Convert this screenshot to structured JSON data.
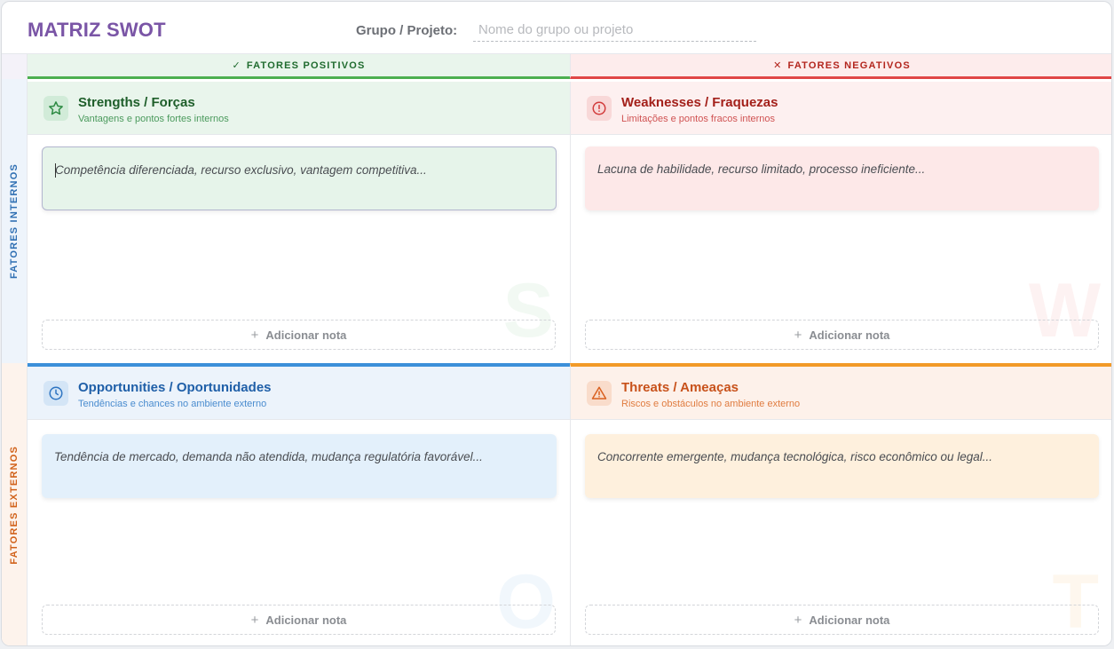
{
  "header": {
    "title": "MATRIZ SWOT",
    "group_label": "Grupo / Projeto:",
    "group_placeholder": "Nome do grupo ou projeto",
    "group_value": ""
  },
  "columns": {
    "positive": {
      "icon": "check-icon",
      "glyph": "✓",
      "label": "FATORES POSITIVOS",
      "color": "#4caf50"
    },
    "negative": {
      "icon": "x-icon",
      "glyph": "✕",
      "label": "FATORES NEGATIVOS",
      "color": "#e04646"
    }
  },
  "rows": {
    "internal": {
      "label": "FATORES INTERNOS",
      "color": "#2f6fb3"
    },
    "external": {
      "label": "FATORES EXTERNOS",
      "color": "#d1621a"
    }
  },
  "quadrants": {
    "strengths": {
      "icon": "star-icon",
      "title": "Strengths / Forças",
      "subtitle": "Vantagens e pontos fortes internos",
      "note_placeholder": "Competência diferenciada, recurso exclusivo, vantagem competitiva...",
      "add_label": "Adicionar nota",
      "letter": "S",
      "color": "#4caf50"
    },
    "weaknesses": {
      "icon": "alert-circle-icon",
      "title": "Weaknesses / Fraquezas",
      "subtitle": "Limitações e pontos fracos internos",
      "note_placeholder": "Lacuna de habilidade, recurso limitado, processo ineficiente...",
      "add_label": "Adicionar nota",
      "letter": "W",
      "color": "#e04646"
    },
    "opportunities": {
      "icon": "clock-icon",
      "title": "Opportunities / Oportunidades",
      "subtitle": "Tendências e chances no ambiente externo",
      "note_placeholder": "Tendência de mercado, demanda não atendida, mudança regulatória favorável...",
      "add_label": "Adicionar nota",
      "letter": "O",
      "color": "#3b8fd9"
    },
    "threats": {
      "icon": "warning-triangle-icon",
      "title": "Threats / Ameaças",
      "subtitle": "Riscos e obstáculos no ambiente externo",
      "note_placeholder": "Concorrente emergente, mudança tecnológica, risco econômico ou legal...",
      "add_label": "Adicionar nota",
      "letter": "T",
      "color": "#f29a27"
    }
  },
  "add_glyph": "+"
}
